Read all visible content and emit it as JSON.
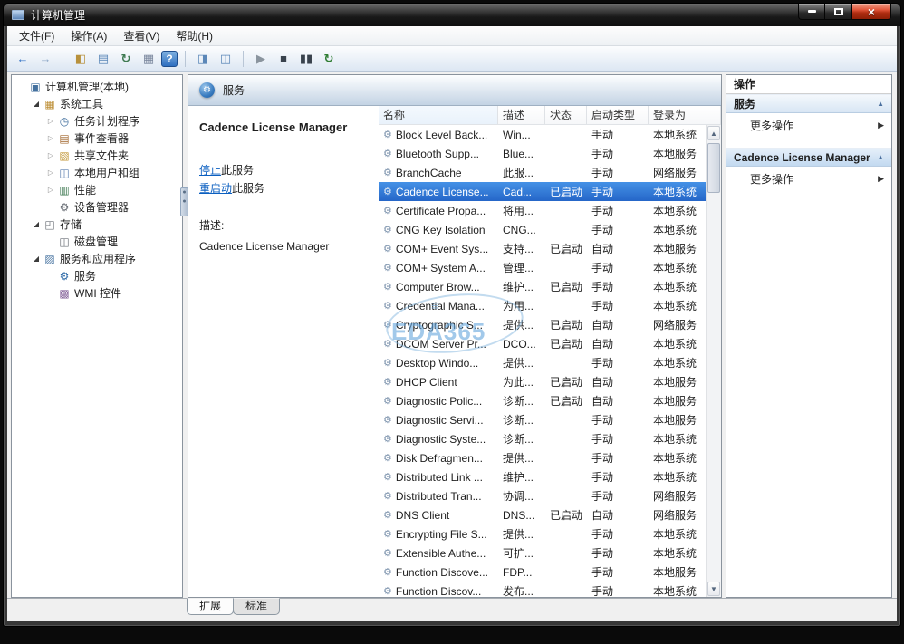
{
  "window": {
    "title": "计算机管理"
  },
  "menubar": {
    "items": [
      {
        "label": "文件(F)"
      },
      {
        "label": "操作(A)"
      },
      {
        "label": "查看(V)"
      },
      {
        "label": "帮助(H)"
      }
    ]
  },
  "toolbar": {
    "buttons": [
      {
        "name": "back-icon",
        "glyph": "←",
        "color": "#2e6fc4"
      },
      {
        "name": "forward-icon",
        "glyph": "→",
        "color": "#8fa9c9"
      },
      {
        "sep": true
      },
      {
        "name": "show-console-tree-icon",
        "glyph": "◧",
        "color": "#b8913c"
      },
      {
        "name": "properties-icon",
        "glyph": "▤",
        "color": "#5b87b8"
      },
      {
        "name": "refresh-icon",
        "glyph": "↻",
        "color": "#3f7a52"
      },
      {
        "name": "export-list-icon",
        "glyph": "▦",
        "color": "#76839a"
      },
      {
        "name": "help-icon",
        "glyph": "?",
        "help": true
      },
      {
        "sep": true
      },
      {
        "name": "show-action-pane-icon",
        "glyph": "◨",
        "color": "#5b87b8"
      },
      {
        "name": "extended-view-icon",
        "glyph": "◫",
        "color": "#5b87b8"
      },
      {
        "sep": true
      },
      {
        "name": "start-service-icon",
        "glyph": "▶",
        "color": "#8a949e"
      },
      {
        "name": "stop-service-icon",
        "glyph": "■",
        "color": "#39424d"
      },
      {
        "name": "pause-service-icon",
        "glyph": "▮▮",
        "color": "#39424d"
      },
      {
        "name": "restart-service-icon",
        "glyph": "↻",
        "color": "#2f7d33"
      }
    ]
  },
  "tree": {
    "items": [
      {
        "label": "计算机管理(本地)",
        "icon": "computer-icon",
        "expander": "none",
        "level": 0
      },
      {
        "label": "系统工具",
        "icon": "system-tools-icon",
        "expander": "expanded",
        "level": 1
      },
      {
        "label": "任务计划程序",
        "icon": "task-scheduler-icon",
        "expander": "collapsed",
        "level": 2
      },
      {
        "label": "事件查看器",
        "icon": "event-viewer-icon",
        "expander": "collapsed",
        "level": 2
      },
      {
        "label": "共享文件夹",
        "icon": "shared-folders-icon",
        "expander": "collapsed",
        "level": 2
      },
      {
        "label": "本地用户和组",
        "icon": "local-users-icon",
        "expander": "collapsed",
        "level": 2
      },
      {
        "label": "性能",
        "icon": "performance-icon",
        "expander": "collapsed",
        "level": 2
      },
      {
        "label": "设备管理器",
        "icon": "device-manager-icon",
        "expander": "none",
        "level": 2
      },
      {
        "label": "存储",
        "icon": "storage-icon",
        "expander": "expanded",
        "level": 1
      },
      {
        "label": "磁盘管理",
        "icon": "disk-management-icon",
        "expander": "none",
        "level": 2
      },
      {
        "label": "服务和应用程序",
        "icon": "services-apps-icon",
        "expander": "expanded",
        "level": 1
      },
      {
        "label": "服务",
        "icon": "services-icon",
        "expander": "none",
        "level": 2
      },
      {
        "label": "WMI 控件",
        "icon": "wmi-icon",
        "expander": "none",
        "level": 2
      }
    ]
  },
  "center": {
    "header": {
      "title": "服务"
    },
    "extended": {
      "service_title": "Cadence License Manager",
      "links": [
        {
          "action": "停止",
          "rest": "此服务"
        },
        {
          "action": "重启动",
          "rest": "此服务"
        }
      ],
      "description_label": "描述:",
      "description_text": "Cadence License Manager"
    },
    "watermark": "EDA365",
    "table": {
      "columns": [
        "名称",
        "描述",
        "状态",
        "启动类型",
        "登录为"
      ],
      "rows": [
        {
          "name": "Block Level Back...",
          "desc": "Win...",
          "status": "",
          "startup": "手动",
          "logon": "本地系统"
        },
        {
          "name": "Bluetooth Supp...",
          "desc": "Blue...",
          "status": "",
          "startup": "手动",
          "logon": "本地服务"
        },
        {
          "name": "BranchCache",
          "desc": "此服...",
          "status": "",
          "startup": "手动",
          "logon": "网络服务"
        },
        {
          "name": "Cadence License...",
          "desc": "Cad...",
          "status": "已启动",
          "startup": "手动",
          "logon": "本地系统",
          "selected": true
        },
        {
          "name": "Certificate Propa...",
          "desc": "将用...",
          "status": "",
          "startup": "手动",
          "logon": "本地系统"
        },
        {
          "name": "CNG Key Isolation",
          "desc": "CNG...",
          "status": "",
          "startup": "手动",
          "logon": "本地系统"
        },
        {
          "name": "COM+ Event Sys...",
          "desc": "支持...",
          "status": "已启动",
          "startup": "自动",
          "logon": "本地服务"
        },
        {
          "name": "COM+ System A...",
          "desc": "管理...",
          "status": "",
          "startup": "手动",
          "logon": "本地系统"
        },
        {
          "name": "Computer Brow...",
          "desc": "维护...",
          "status": "已启动",
          "startup": "手动",
          "logon": "本地系统"
        },
        {
          "name": "Credential Mana...",
          "desc": "为用...",
          "status": "",
          "startup": "手动",
          "logon": "本地系统"
        },
        {
          "name": "Cryptographic S...",
          "desc": "提供...",
          "status": "已启动",
          "startup": "自动",
          "logon": "网络服务"
        },
        {
          "name": "DCOM Server Pr...",
          "desc": "DCO...",
          "status": "已启动",
          "startup": "自动",
          "logon": "本地系统"
        },
        {
          "name": "Desktop Windo...",
          "desc": "提供...",
          "status": "",
          "startup": "手动",
          "logon": "本地系统"
        },
        {
          "name": "DHCP Client",
          "desc": "为此...",
          "status": "已启动",
          "startup": "自动",
          "logon": "本地服务"
        },
        {
          "name": "Diagnostic Polic...",
          "desc": "诊断...",
          "status": "已启动",
          "startup": "自动",
          "logon": "本地服务"
        },
        {
          "name": "Diagnostic Servi...",
          "desc": "诊断...",
          "status": "",
          "startup": "手动",
          "logon": "本地服务"
        },
        {
          "name": "Diagnostic Syste...",
          "desc": "诊断...",
          "status": "",
          "startup": "手动",
          "logon": "本地系统"
        },
        {
          "name": "Disk Defragmen...",
          "desc": "提供...",
          "status": "",
          "startup": "手动",
          "logon": "本地系统"
        },
        {
          "name": "Distributed Link ...",
          "desc": "维护...",
          "status": "",
          "startup": "手动",
          "logon": "本地系统"
        },
        {
          "name": "Distributed Tran...",
          "desc": "协调...",
          "status": "",
          "startup": "手动",
          "logon": "网络服务"
        },
        {
          "name": "DNS Client",
          "desc": "DNS...",
          "status": "已启动",
          "startup": "自动",
          "logon": "网络服务"
        },
        {
          "name": "Encrypting File S...",
          "desc": "提供...",
          "status": "",
          "startup": "手动",
          "logon": "本地系统"
        },
        {
          "name": "Extensible Authe...",
          "desc": "可扩...",
          "status": "",
          "startup": "手动",
          "logon": "本地系统"
        },
        {
          "name": "Function Discove...",
          "desc": "FDP...",
          "status": "",
          "startup": "手动",
          "logon": "本地服务"
        },
        {
          "name": "Function Discov...",
          "desc": "发布...",
          "status": "",
          "startup": "手动",
          "logon": "本地系统"
        }
      ]
    }
  },
  "actions": {
    "title": "操作",
    "sections": [
      {
        "title": "服务",
        "more_label": "更多操作"
      },
      {
        "title": "Cadence License Manager",
        "more_label": "更多操作"
      }
    ]
  },
  "tabs": {
    "items": [
      {
        "label": "扩展",
        "active": true
      },
      {
        "label": "标准",
        "active": false
      }
    ]
  },
  "colors": {
    "selection": "#2e6fce",
    "link": "#0b5fc0",
    "close_button": "#b02e12"
  }
}
